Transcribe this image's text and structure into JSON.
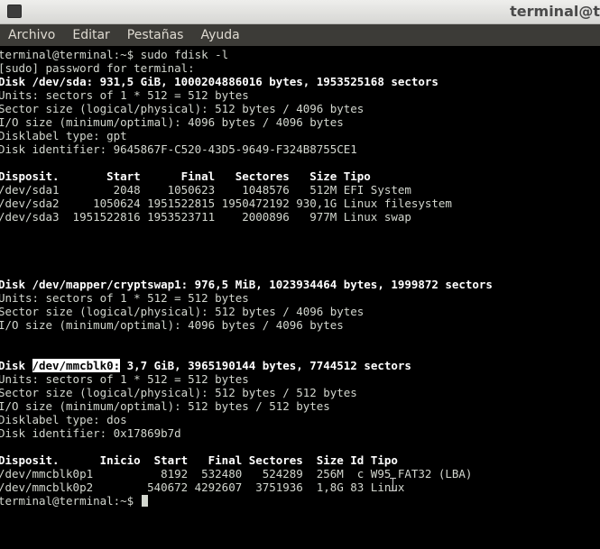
{
  "window": {
    "title": "terminal@t"
  },
  "menu": [
    "Archivo",
    "Editar",
    "Pestañas",
    "Ayuda"
  ],
  "terminal": {
    "lines": [
      "terminal@terminal:~$ sudo fdisk -l",
      "[sudo] password for terminal:",
      "Disk /dev/sda: 931,5 GiB, 1000204886016 bytes, 1953525168 sectors",
      "Units: sectors of 1 * 512 = 512 bytes",
      "Sector size (logical/physical): 512 bytes / 4096 bytes",
      "I/O size (minimum/optimal): 4096 bytes / 4096 bytes",
      "Disklabel type: gpt",
      "Disk identifier: 9645867F-C520-43D5-9649-F324B8755CE1",
      "",
      "Disposit.       Start      Final   Sectores   Size Tipo",
      "/dev/sda1        2048    1050623    1048576   512M EFI System",
      "/dev/sda2     1050624 1951522815 1950472192 930,1G Linux filesystem",
      "/dev/sda3  1951522816 1953523711    2000896   977M Linux swap",
      "",
      "",
      "",
      "",
      "Disk /dev/mapper/cryptswap1: 976,5 MiB, 1023934464 bytes, 1999872 sectors",
      "Units: sectors of 1 * 512 = 512 bytes",
      "Sector size (logical/physical): 512 bytes / 4096 bytes",
      "I/O size (minimum/optimal): 4096 bytes / 4096 bytes",
      "",
      "",
      "Disk /dev/mmcblk0: 3,7 GiB, 3965190144 bytes, 7744512 sectors",
      "Units: sectors of 1 * 512 = 512 bytes",
      "Sector size (logical/physical): 512 bytes / 512 bytes",
      "I/O size (minimum/optimal): 512 bytes / 512 bytes",
      "Disklabel type: dos",
      "Disk identifier: 0x17869b7d",
      "",
      "Disposit.      Inicio  Start   Final Sectores  Size Id Tipo",
      "/dev/mmcblk0p1          8192  532480   524289  256M  c W95 FAT32 (LBA)",
      "/dev/mmcblk0p2        540672 4292607  3751936  1,8G 83 Linux",
      "terminal@terminal:~$ "
    ],
    "bold_lines": [
      2,
      9,
      17,
      23,
      30
    ],
    "selection": {
      "line": 23,
      "text": "/dev/mmcblk0:"
    },
    "cursor_line": 33
  }
}
